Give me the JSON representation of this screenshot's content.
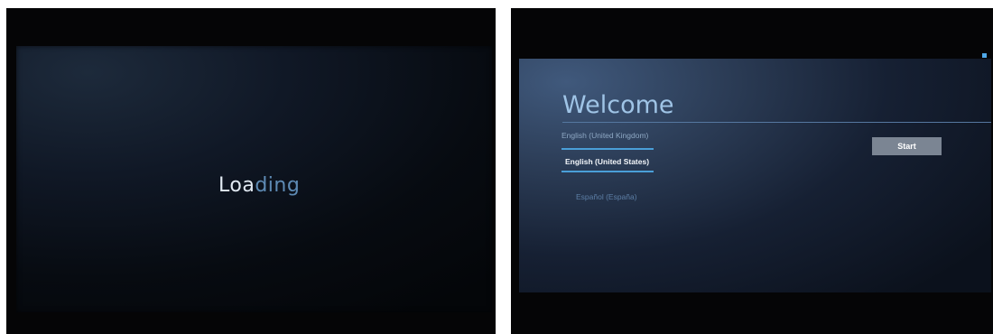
{
  "left_screen": {
    "loading_bright": "Loa",
    "loading_dim": "ding"
  },
  "right_screen": {
    "title": "Welcome",
    "languages": [
      {
        "label": "English (United Kingdom)",
        "state": "previous"
      },
      {
        "label": "English (United States)",
        "state": "selected"
      },
      {
        "label": "Español (España)",
        "state": "next"
      }
    ],
    "start_button_label": "Start"
  },
  "colors": {
    "accent": "#4a9fd8",
    "title_color": "#9fc4e6",
    "button_bg": "#7b8593"
  }
}
